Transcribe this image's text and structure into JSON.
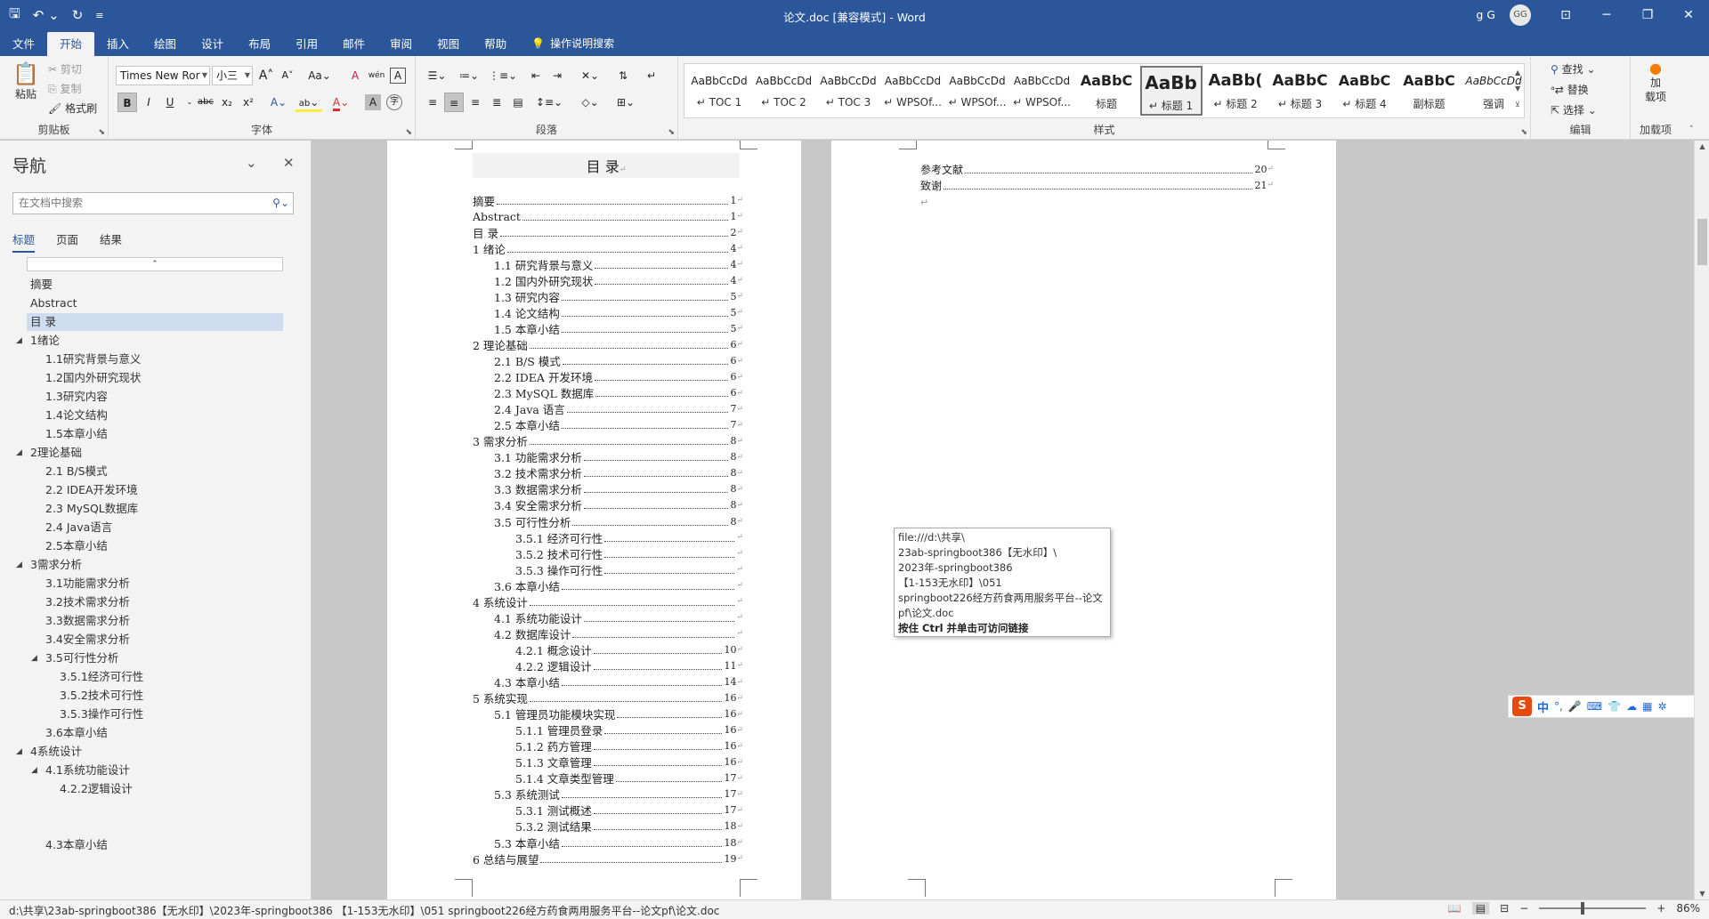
{
  "titlebar": {
    "title": "论文.doc [兼容模式] - Word",
    "user": "g G",
    "avatar": "GG",
    "qat": {
      "save_icon": "save-icon",
      "undo_icon": "undo-icon",
      "redo_icon": "redo-icon",
      "customize_icon": "customize-icon"
    }
  },
  "menu": {
    "tabs": [
      "文件",
      "开始",
      "插入",
      "绘图",
      "设计",
      "布局",
      "引用",
      "邮件",
      "审阅",
      "视图",
      "帮助"
    ],
    "active": "开始",
    "tell_me": "操作说明搜索"
  },
  "ribbon": {
    "clipboard": {
      "paste": "粘贴",
      "cut": "剪切",
      "copy": "复制",
      "format_painter": "格式刷",
      "label": "剪贴板"
    },
    "font": {
      "name": "Times New Ror",
      "size": "小三",
      "label": "字体",
      "bold": "B",
      "italic": "I",
      "underline": "U",
      "strike": "abc",
      "sub": "x₂",
      "sup": "x²",
      "grow": "A",
      "shrink": "A",
      "case": "Aa",
      "clear": "A",
      "wen": "wén",
      "charborder": "A",
      "effects": "A",
      "highlight": "ab",
      "color": "A",
      "shade": "A",
      "enclose": "字"
    },
    "paragraph": {
      "label": "段落"
    },
    "styles": {
      "label": "样式",
      "items": [
        {
          "preview": "AaBbCcDd",
          "name": "↵ TOC 1"
        },
        {
          "preview": "AaBbCcDd",
          "name": "↵ TOC 2"
        },
        {
          "preview": "AaBbCcDd",
          "name": "↵ TOC 3"
        },
        {
          "preview": "AaBbCcDd",
          "name": "↵ WPSOf..."
        },
        {
          "preview": "AaBbCcDd",
          "name": "↵ WPSOf..."
        },
        {
          "preview": "AaBbCcDd",
          "name": "↵ WPSOf..."
        },
        {
          "preview": "AaBbC",
          "name": "标题"
        },
        {
          "preview": "AaBb",
          "name": "↵ 标题 1"
        },
        {
          "preview": "AaBb(",
          "name": "↵ 标题 2"
        },
        {
          "preview": "AaBbC",
          "name": "↵ 标题 3"
        },
        {
          "preview": "AaBbC",
          "name": "↵ 标题 4"
        },
        {
          "preview": "AaBbC",
          "name": "副标题"
        },
        {
          "preview": "AaBbCcDd",
          "name": "强调"
        }
      ]
    },
    "editing": {
      "find": "查找",
      "replace": "替换",
      "select": "选择",
      "label": "编辑"
    },
    "addins": {
      "button": "加\n载项",
      "label": "加载项"
    }
  },
  "nav": {
    "title": "导航",
    "search_placeholder": "在文档中搜索",
    "tabs": [
      "标题",
      "页面",
      "结果"
    ],
    "active_tab": "标题",
    "items": [
      {
        "label": "摘要",
        "level": 1,
        "expander": ""
      },
      {
        "label": "Abstract",
        "level": 1,
        "expander": ""
      },
      {
        "label": "目  录",
        "level": 1,
        "expander": "",
        "selected": true
      },
      {
        "label": "1绪论",
        "level": 1,
        "expander": "◢"
      },
      {
        "label": "1.1研究背景与意义",
        "level": 2,
        "expander": ""
      },
      {
        "label": "1.2国内外研究现状",
        "level": 2,
        "expander": ""
      },
      {
        "label": "1.3研究内容",
        "level": 2,
        "expander": ""
      },
      {
        "label": "1.4论文结构",
        "level": 2,
        "expander": ""
      },
      {
        "label": "1.5本章小结",
        "level": 2,
        "expander": ""
      },
      {
        "label": "2理论基础",
        "level": 1,
        "expander": "◢"
      },
      {
        "label": "2.1 B/S模式",
        "level": 2,
        "expander": ""
      },
      {
        "label": "2.2 IDEA开发环境",
        "level": 2,
        "expander": ""
      },
      {
        "label": "2.3 MySQL数据库",
        "level": 2,
        "expander": ""
      },
      {
        "label": "2.4 Java语言",
        "level": 2,
        "expander": ""
      },
      {
        "label": "2.5本章小结",
        "level": 2,
        "expander": ""
      },
      {
        "label": "3需求分析",
        "level": 1,
        "expander": "◢"
      },
      {
        "label": "3.1功能需求分析",
        "level": 2,
        "expander": ""
      },
      {
        "label": "3.2技术需求分析",
        "level": 2,
        "expander": ""
      },
      {
        "label": "3.3数据需求分析",
        "level": 2,
        "expander": ""
      },
      {
        "label": "3.4安全需求分析",
        "level": 2,
        "expander": ""
      },
      {
        "label": "3.5可行性分析",
        "level": 2,
        "expander": "◢"
      },
      {
        "label": "3.5.1经济可行性",
        "level": 3,
        "expander": ""
      },
      {
        "label": "3.5.2技术可行性",
        "level": 3,
        "expander": ""
      },
      {
        "label": "3.5.3操作可行性",
        "level": 3,
        "expander": ""
      },
      {
        "label": "3.6本章小结",
        "level": 2,
        "expander": ""
      },
      {
        "label": "4系统设计",
        "level": 1,
        "expander": "◢"
      },
      {
        "label": "4.1系统功能设计",
        "level": 2,
        "expander": "◢"
      },
      {
        "label": "4.2.2逻辑设计",
        "level": 3,
        "expander": ""
      },
      {
        "label": "",
        "level": 1,
        "expander": ""
      },
      {
        "label": "",
        "level": 1,
        "expander": ""
      },
      {
        "label": "4.3本章小结",
        "level": 2,
        "expander": ""
      }
    ]
  },
  "doc": {
    "toc_title": "目  录",
    "left_entries": [
      {
        "text": "摘要",
        "page": "1",
        "level": 1
      },
      {
        "text": "Abstract",
        "page": "1",
        "level": 1
      },
      {
        "text": "目  录",
        "page": "2",
        "level": 1
      },
      {
        "text": "1 绪论",
        "page": "4",
        "level": 1
      },
      {
        "text": "1.1 研究背景与意义",
        "page": "4",
        "level": 2
      },
      {
        "text": "1.2 国内外研究现状",
        "page": "4",
        "level": 2
      },
      {
        "text": "1.3 研究内容",
        "page": "5",
        "level": 2
      },
      {
        "text": "1.4 论文结构",
        "page": "5",
        "level": 2
      },
      {
        "text": "1.5 本章小结",
        "page": "5",
        "level": 2
      },
      {
        "text": "2 理论基础",
        "page": "6",
        "level": 1
      },
      {
        "text": "2.1 B/S 模式",
        "page": "6",
        "level": 2
      },
      {
        "text": "2.2 IDEA 开发环境",
        "page": "6",
        "level": 2
      },
      {
        "text": "2.3 MySQL 数据库",
        "page": "6",
        "level": 2
      },
      {
        "text": "2.4 Java 语言",
        "page": "7",
        "level": 2
      },
      {
        "text": "2.5 本章小结",
        "page": "7",
        "level": 2
      },
      {
        "text": "3 需求分析",
        "page": "8",
        "level": 1
      },
      {
        "text": "3.1 功能需求分析",
        "page": "8",
        "level": 2
      },
      {
        "text": "3.2 技术需求分析",
        "page": "8",
        "level": 2
      },
      {
        "text": "3.3 数据需求分析",
        "page": "8",
        "level": 2
      },
      {
        "text": "3.4 安全需求分析",
        "page": "8",
        "level": 2
      },
      {
        "text": "3.5 可行性分析",
        "page": "8",
        "level": 2
      },
      {
        "text": "3.5.1 经济可行性",
        "page": "",
        "level": 3
      },
      {
        "text": "3.5.2 技术可行性",
        "page": "",
        "level": 3
      },
      {
        "text": "3.5.3 操作可行性",
        "page": "",
        "level": 3
      },
      {
        "text": "3.6 本章小结",
        "page": "",
        "level": 2
      },
      {
        "text": "4 系统设计",
        "page": "",
        "level": 1
      },
      {
        "text": "4.1 系统功能设计",
        "page": "",
        "level": 2
      },
      {
        "text": "4.2 数据库设计",
        "page": "",
        "level": 2
      },
      {
        "text": "4.2.1 概念设计",
        "page": "10",
        "level": 3
      },
      {
        "text": "4.2.2 逻辑设计",
        "page": "11",
        "level": 3
      },
      {
        "text": "4.3 本章小结",
        "page": "14",
        "level": 2
      },
      {
        "text": "5 系统实现",
        "page": "16",
        "level": 1
      },
      {
        "text": "5.1 管理员功能模块实现",
        "page": "16",
        "level": 2
      },
      {
        "text": "5.1.1 管理员登录",
        "page": "16",
        "level": 3
      },
      {
        "text": "5.1.2 药方管理",
        "page": "16",
        "level": 3
      },
      {
        "text": "5.1.3 文章管理",
        "page": "16",
        "level": 3
      },
      {
        "text": "5.1.4 文章类型管理",
        "page": "17",
        "level": 3
      },
      {
        "text": "5.3 系统测试",
        "page": "17",
        "level": 2
      },
      {
        "text": "5.3.1 测试概述",
        "page": "17",
        "level": 3
      },
      {
        "text": "5.3.2 测试结果",
        "page": "18",
        "level": 3
      },
      {
        "text": "5.3 本章小结",
        "page": "18",
        "level": 2
      },
      {
        "text": "6 总结与展望",
        "page": "19",
        "level": 1
      }
    ],
    "right_entries": [
      {
        "text": "参考文献",
        "page": "20"
      },
      {
        "text": "致谢",
        "page": "21"
      }
    ]
  },
  "tooltip": {
    "lines": [
      "file:///d:\\共享\\",
      "23ab-springboot386【无水印】\\",
      "2023年-springboot386",
      "【1-153无水印】\\051",
      "springboot226经方药食两用服务平台--论文",
      "pf\\论文.doc"
    ],
    "hint": "按住 Ctrl 并单击可访问链接"
  },
  "ime": {
    "logo": "S",
    "mode": "中",
    "items": [
      "°,",
      "🎤",
      "⌨",
      "👕",
      "☁",
      "▦",
      "✲"
    ]
  },
  "statusbar": {
    "path": "d:\\共享\\23ab-springboot386【无水印】\\2023年-springboot386 【1-153无水印】\\051 springboot226经方药食两用服务平台--论文pf\\论文.doc",
    "zoom": "86%",
    "zoom_level": 0.4
  }
}
